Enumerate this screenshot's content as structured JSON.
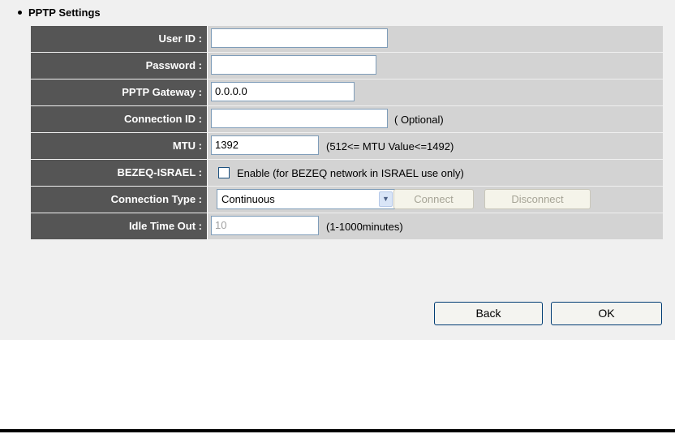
{
  "section_title": "PPTP Settings",
  "fields": {
    "user_id": {
      "label": "User ID :",
      "value": ""
    },
    "password": {
      "label": "Password :",
      "value": ""
    },
    "gateway": {
      "label": "PPTP Gateway :",
      "value": "0.0.0.0"
    },
    "connection_id": {
      "label": "Connection ID :",
      "value": "",
      "hint": "( Optional)"
    },
    "mtu": {
      "label": "MTU :",
      "value": "1392",
      "hint": "(512<= MTU Value<=1492)"
    },
    "bezeq": {
      "label": "BEZEQ-ISRAEL :",
      "checked": false,
      "checkbox_text": "Enable (for BEZEQ network in ISRAEL use only)"
    },
    "connection_type": {
      "label": "Connection Type :",
      "selected": "Continuous",
      "connect_label": "Connect",
      "disconnect_label": "Disconnect"
    },
    "idle_timeout": {
      "label": "Idle Time Out :",
      "value": "10",
      "hint": "(1-1000minutes)"
    }
  },
  "buttons": {
    "back": "Back",
    "ok": "OK"
  },
  "icons": {
    "bullet": "bullet-icon",
    "select_arrow": "chevron-down-icon"
  },
  "colors": {
    "label_bg": "#555555",
    "value_bg": "#d3d3d3",
    "panel_bg": "#f0f0f0"
  }
}
